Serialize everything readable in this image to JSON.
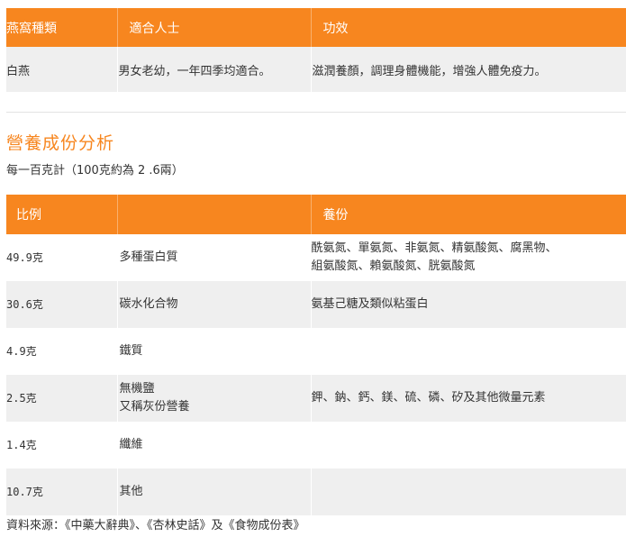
{
  "type_table": {
    "headers": [
      "燕窩種類",
      "適合人士",
      "功效"
    ],
    "rows": [
      [
        "白燕",
        "男女老幼，一年四季均適合。",
        "滋潤養顏，調理身體機能，增強人體免疫力。"
      ]
    ]
  },
  "nutrition": {
    "title": "營養成份分析",
    "subtitle": "每一百克計（100克約為 2 .6兩）",
    "headers": [
      "比例",
      "",
      "養份"
    ],
    "rows": [
      [
        "49.9克",
        "多種蛋白質",
        "酰氨氮、單氨氮、非氨氮、精氨酸氮、腐黑物、\n組氨酸氮、賴氨酸氮、胱氨酸氮"
      ],
      [
        "30.6克",
        "碳水化合物",
        "氨基己糖及類似粘蛋白"
      ],
      [
        "4.9克",
        "鐵質",
        ""
      ],
      [
        "2.5克",
        "無機鹽\n又稱灰份營養",
        "鉀、鈉、鈣、鎂、硫、磷、矽及其他微量元素"
      ],
      [
        "1.4克",
        "纖維",
        ""
      ],
      [
        "10.7克",
        "其他",
        ""
      ]
    ]
  },
  "source": "資料來源：《中藥大辭典》、《杏林史話》及《食物成份表》",
  "colors": {
    "accent": "#f7861f",
    "row_alt": "#efefef"
  }
}
